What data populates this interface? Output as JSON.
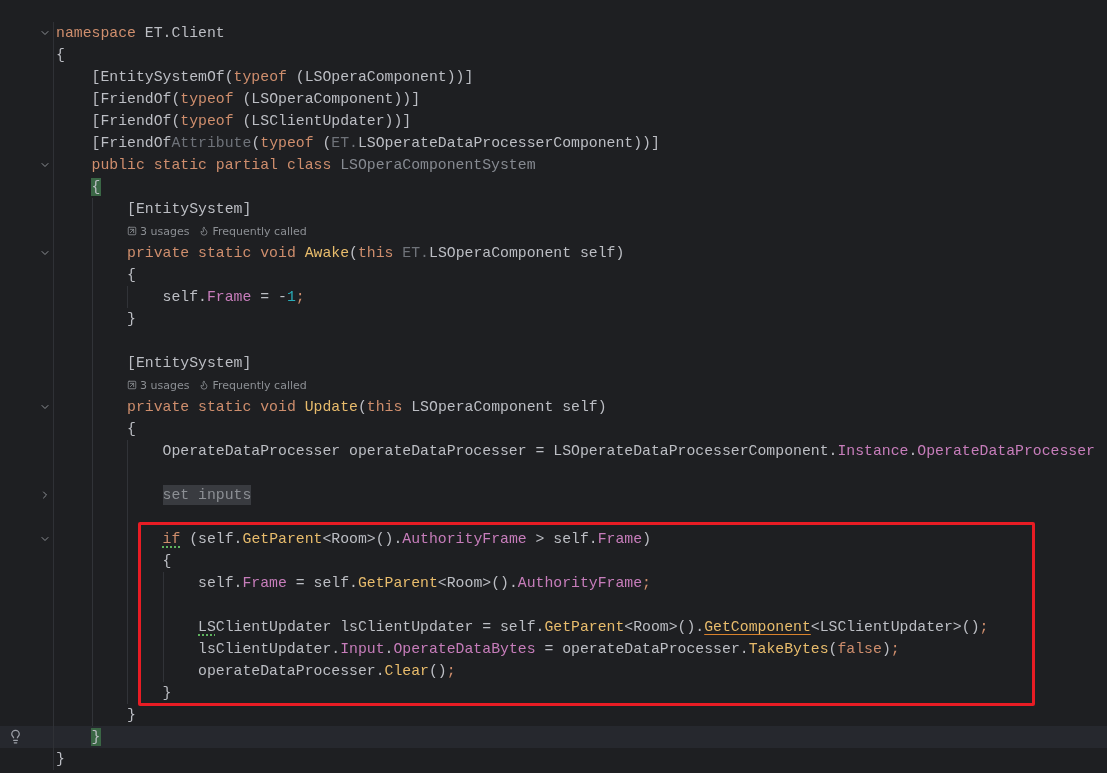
{
  "editor": {
    "lines": [
      {
        "kind": "code",
        "folded": false,
        "tokens": [
          {
            "text": "namespace",
            "kind": "keyword"
          },
          {
            "text": " ET.Client",
            "kind": "plain"
          }
        ]
      },
      {
        "kind": "code",
        "tokens": [
          {
            "text": "{",
            "kind": "plain"
          }
        ]
      },
      {
        "kind": "code",
        "tokens": [
          {
            "text": "    [EntitySystemOf(",
            "kind": "plain"
          },
          {
            "text": "typeof",
            "kind": "keyword"
          },
          {
            "text": " (LSOperaComponent))]",
            "kind": "plain"
          }
        ]
      },
      {
        "kind": "code",
        "tokens": [
          {
            "text": "    [FriendOf(",
            "kind": "plain"
          },
          {
            "text": "typeof",
            "kind": "keyword"
          },
          {
            "text": " (LSOperaComponent))]",
            "kind": "plain"
          }
        ]
      },
      {
        "kind": "code",
        "tokens": [
          {
            "text": "    [FriendOf(",
            "kind": "plain"
          },
          {
            "text": "typeof",
            "kind": "keyword"
          },
          {
            "text": " (LSClientUpdater))]",
            "kind": "plain"
          }
        ]
      },
      {
        "kind": "code",
        "tokens": [
          {
            "text": "    [FriendOf",
            "kind": "plain"
          },
          {
            "text": "Attribute",
            "kind": "dim"
          },
          {
            "text": "(",
            "kind": "plain"
          },
          {
            "text": "typeof",
            "kind": "keyword"
          },
          {
            "text": " (",
            "kind": "plain"
          },
          {
            "text": "ET.",
            "kind": "dim"
          },
          {
            "text": "LSOperateDataProcesserComponent))]",
            "kind": "plain"
          }
        ]
      },
      {
        "kind": "code",
        "folded": false,
        "tokens": [
          {
            "text": "    public static partial class",
            "kind": "keyword"
          },
          {
            "text": " LSOperaComponentSystem",
            "kind": "unused"
          }
        ]
      },
      {
        "kind": "code",
        "tokens": [
          {
            "text": "    {",
            "kind": "plain",
            "match": true
          }
        ]
      },
      {
        "kind": "code",
        "tokens": [
          {
            "text": "        [EntitySystem]",
            "kind": "plain"
          }
        ]
      },
      {
        "kind": "hints",
        "hints": [
          {
            "kind": "usages",
            "text": "3 usages"
          },
          {
            "kind": "frequency",
            "text": "Frequently called"
          }
        ]
      },
      {
        "kind": "code",
        "folded": false,
        "tokens": [
          {
            "text": "        private static void",
            "kind": "keyword"
          },
          {
            "text": " Awake",
            "kind": "method"
          },
          {
            "text": "(",
            "kind": "plain"
          },
          {
            "text": "this",
            "kind": "keyword"
          },
          {
            "text": " ET.",
            "kind": "dim"
          },
          {
            "text": "LSOperaComponent self)",
            "kind": "plain"
          }
        ]
      },
      {
        "kind": "code",
        "tokens": [
          {
            "text": "        {",
            "kind": "plain"
          }
        ]
      },
      {
        "kind": "code",
        "tokens": [
          {
            "text": "            self.",
            "kind": "plain"
          },
          {
            "text": "Frame",
            "kind": "property"
          },
          {
            "text": " = -",
            "kind": "plain"
          },
          {
            "text": "1",
            "kind": "number"
          },
          {
            "text": ";",
            "kind": "keyword"
          }
        ]
      },
      {
        "kind": "code",
        "tokens": [
          {
            "text": "        }",
            "kind": "plain"
          }
        ]
      },
      {
        "kind": "blank"
      },
      {
        "kind": "code",
        "tokens": [
          {
            "text": "        [EntitySystem]",
            "kind": "plain"
          }
        ]
      },
      {
        "kind": "hints",
        "hints": [
          {
            "kind": "usages",
            "text": "3 usages"
          },
          {
            "kind": "frequency",
            "text": "Frequently called"
          }
        ]
      },
      {
        "kind": "code",
        "folded": false,
        "tokens": [
          {
            "text": "        private static void",
            "kind": "keyword"
          },
          {
            "text": " Update",
            "kind": "method"
          },
          {
            "text": "(",
            "kind": "plain"
          },
          {
            "text": "this",
            "kind": "keyword"
          },
          {
            "text": " LSOperaComponent self)",
            "kind": "plain"
          }
        ]
      },
      {
        "kind": "code",
        "tokens": [
          {
            "text": "        {",
            "kind": "plain"
          }
        ]
      },
      {
        "kind": "code",
        "tokens": [
          {
            "text": "            OperateDataProcesser operateDataProcesser = LSOperateDataProcesserComponent.",
            "kind": "plain"
          },
          {
            "text": "Instance",
            "kind": "property"
          },
          {
            "text": ".",
            "kind": "plain"
          },
          {
            "text": "OperateDataProcesser",
            "kind": "property"
          }
        ]
      },
      {
        "kind": "blank"
      },
      {
        "kind": "code",
        "folded": true,
        "tokens": [
          {
            "text": "            set inputs",
            "kind": "folded"
          }
        ]
      },
      {
        "kind": "blank"
      },
      {
        "kind": "code",
        "folded": false,
        "tokens": [
          {
            "text": "            if",
            "kind": "keyword",
            "weak_warning": true
          },
          {
            "text": " (self.",
            "kind": "plain"
          },
          {
            "text": "GetParent",
            "kind": "method"
          },
          {
            "text": "<Room>().",
            "kind": "plain"
          },
          {
            "text": "AuthorityFrame",
            "kind": "property"
          },
          {
            "text": " > self.",
            "kind": "plain"
          },
          {
            "text": "Frame",
            "kind": "property"
          },
          {
            "text": ")",
            "kind": "plain"
          }
        ]
      },
      {
        "kind": "code",
        "tokens": [
          {
            "text": "            {",
            "kind": "plain"
          }
        ]
      },
      {
        "kind": "code",
        "tokens": [
          {
            "text": "                self.",
            "kind": "plain"
          },
          {
            "text": "Frame",
            "kind": "property"
          },
          {
            "text": " = self.",
            "kind": "plain"
          },
          {
            "text": "GetParent",
            "kind": "method"
          },
          {
            "text": "<Room>().",
            "kind": "plain"
          },
          {
            "text": "AuthorityFrame",
            "kind": "property"
          },
          {
            "text": ";",
            "kind": "keyword"
          }
        ]
      },
      {
        "kind": "blank"
      },
      {
        "kind": "code",
        "tokens": [
          {
            "text": "                LS",
            "kind": "plain",
            "weak_warning": true
          },
          {
            "text": "ClientUpdater lsClientUpdater = self.",
            "kind": "plain"
          },
          {
            "text": "GetParent",
            "kind": "method"
          },
          {
            "text": "<Room>().",
            "kind": "plain"
          },
          {
            "text": "GetComponent",
            "kind": "method",
            "warning": true
          },
          {
            "text": "<LSClientUpdater>()",
            "kind": "plain"
          },
          {
            "text": ";",
            "kind": "keyword"
          }
        ]
      },
      {
        "kind": "code",
        "tokens": [
          {
            "text": "                lsClientUpdater.",
            "kind": "plain"
          },
          {
            "text": "Input",
            "kind": "property"
          },
          {
            "text": ".",
            "kind": "plain"
          },
          {
            "text": "OperateDataBytes",
            "kind": "property"
          },
          {
            "text": " = operateDataProcesser.",
            "kind": "plain"
          },
          {
            "text": "TakeBytes",
            "kind": "method"
          },
          {
            "text": "(",
            "kind": "plain"
          },
          {
            "text": "false",
            "kind": "keyword"
          },
          {
            "text": ")",
            "kind": "plain"
          },
          {
            "text": ";",
            "kind": "keyword"
          }
        ]
      },
      {
        "kind": "code",
        "tokens": [
          {
            "text": "                operateDataProcesser.",
            "kind": "plain"
          },
          {
            "text": "Clear",
            "kind": "method"
          },
          {
            "text": "()",
            "kind": "plain"
          },
          {
            "text": ";",
            "kind": "keyword"
          }
        ]
      },
      {
        "kind": "code",
        "tokens": [
          {
            "text": "            }",
            "kind": "plain"
          }
        ]
      },
      {
        "kind": "code",
        "tokens": [
          {
            "text": "        }",
            "kind": "plain"
          }
        ]
      },
      {
        "kind": "code",
        "current": true,
        "bulb": true,
        "tokens": [
          {
            "text": "    }",
            "kind": "plain",
            "match": true
          }
        ]
      },
      {
        "kind": "code",
        "tokens": [
          {
            "text": "}",
            "kind": "plain"
          }
        ]
      }
    ]
  }
}
